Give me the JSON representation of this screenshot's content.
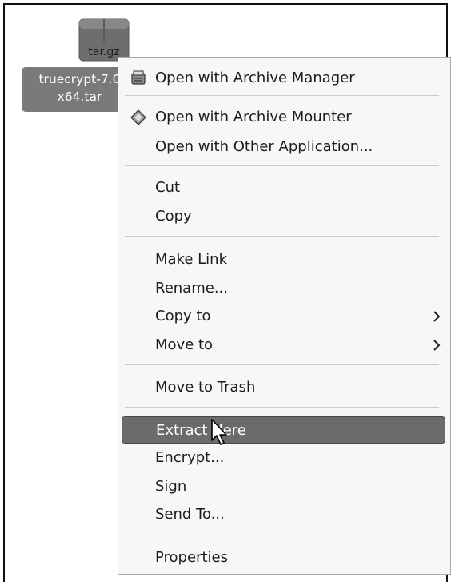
{
  "desktop": {
    "file": {
      "icon_label": "tar.gz",
      "name_line1": "truecrypt-7.0",
      "name_line2": "x64.tar"
    }
  },
  "context_menu": {
    "items": [
      {
        "label": "Open with Archive Manager",
        "icon": "archive-manager-icon"
      },
      {
        "label": "Open with Archive Mounter",
        "icon": "archive-mounter-icon"
      },
      {
        "label": "Open with Other Application..."
      },
      {
        "label": "Cut"
      },
      {
        "label": "Copy"
      },
      {
        "label": "Make Link"
      },
      {
        "label": "Rename..."
      },
      {
        "label": "Copy to",
        "submenu": true
      },
      {
        "label": "Move to",
        "submenu": true
      },
      {
        "label": "Move to Trash"
      },
      {
        "label": "Extract Here",
        "highlighted": true
      },
      {
        "label": "Encrypt..."
      },
      {
        "label": "Sign"
      },
      {
        "label": "Send To..."
      },
      {
        "label": "Properties"
      }
    ]
  }
}
